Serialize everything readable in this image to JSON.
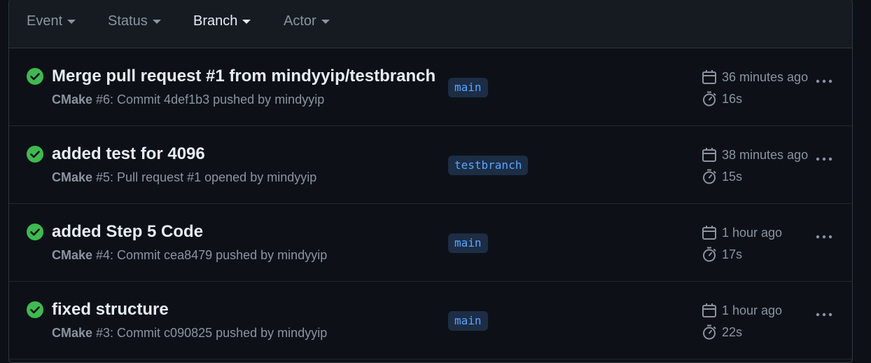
{
  "filters": [
    {
      "label": "Event",
      "active": false
    },
    {
      "label": "Status",
      "active": false
    },
    {
      "label": "Branch",
      "active": true
    },
    {
      "label": "Actor",
      "active": false
    }
  ],
  "runs": [
    {
      "title": "Merge pull request #1 from mindyyip/testbranch",
      "workflow": "CMake",
      "detail": " #6: Commit 4def1b3 pushed by mindyyip",
      "branch": "main",
      "when": "36 minutes ago",
      "duration": "16s",
      "status": "success"
    },
    {
      "title": "added test for 4096",
      "workflow": "CMake",
      "detail": " #5: Pull request #1 opened by mindyyip",
      "branch": "testbranch",
      "when": "38 minutes ago",
      "duration": "15s",
      "status": "success"
    },
    {
      "title": "added Step 5 Code",
      "workflow": "CMake",
      "detail": " #4: Commit cea8479 pushed by mindyyip",
      "branch": "main",
      "when": "1 hour ago",
      "duration": "17s",
      "status": "success"
    },
    {
      "title": "fixed structure",
      "workflow": "CMake",
      "detail": " #3: Commit c090825 pushed by mindyyip",
      "branch": "main",
      "when": "1 hour ago",
      "duration": "22s",
      "status": "success"
    }
  ],
  "colors": {
    "success": "#3fb950",
    "accent": "#58a6ff",
    "muted": "#8b949e",
    "background": "#0d1117",
    "header_bg": "#161b22"
  },
  "icons": {
    "status": "check-circle-icon",
    "when": "calendar-icon",
    "duration": "stopwatch-icon",
    "menu": "kebab-horizontal-icon"
  }
}
